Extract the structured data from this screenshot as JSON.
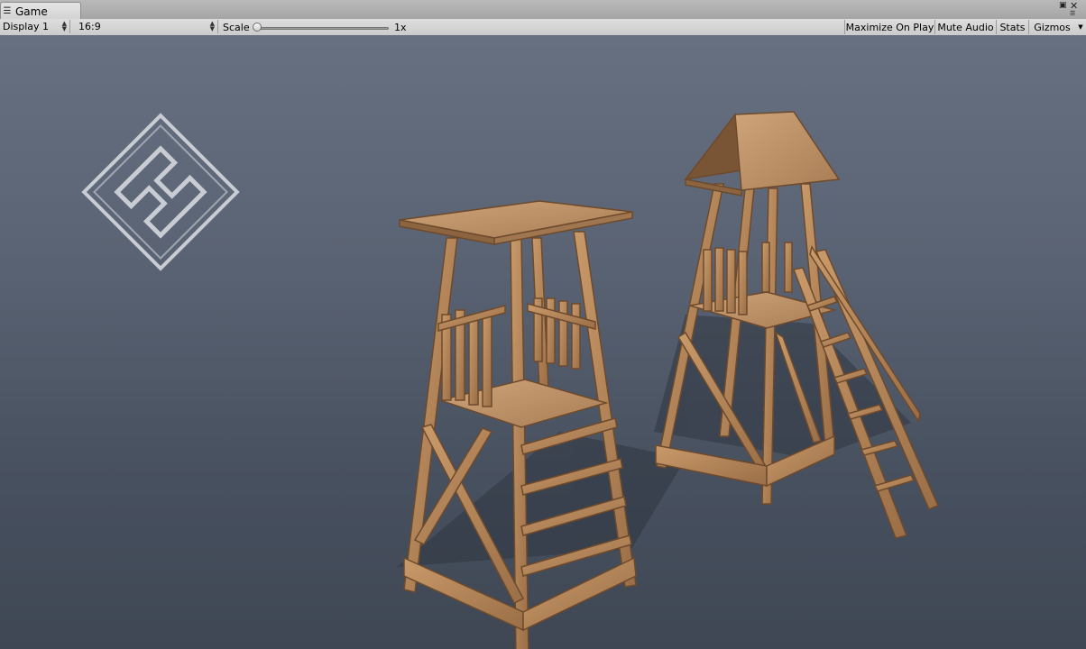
{
  "window": {
    "tab_label": "Game",
    "tab_icon": "unity-game-icon"
  },
  "toolbar": {
    "display": "Display 1",
    "aspect": "16:9",
    "scale_label": "Scale",
    "scale_value": "1x",
    "scale_slider_fraction": 0.0,
    "maximize_on_play": "Maximize On Play",
    "mute_audio": "Mute Audio",
    "stats": "Stats",
    "gizmos": "Gizmos"
  },
  "scene": {
    "objects": [
      "logo-emblem",
      "watchtower-flat-roof",
      "watchtower-pitched-roof-with-stairs"
    ],
    "background_color": "#58616f",
    "wood_color": "#b0835a"
  }
}
